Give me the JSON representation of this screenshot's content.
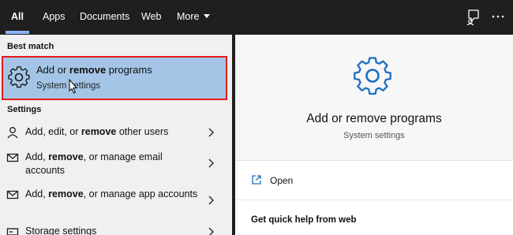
{
  "tabs": [
    {
      "label": "All",
      "active": true
    },
    {
      "label": "Apps"
    },
    {
      "label": "Documents"
    },
    {
      "label": "Web"
    },
    {
      "label": "More"
    }
  ],
  "topbar_icons": [
    "feedback-icon",
    "more-options-icon"
  ],
  "best_match": {
    "section_label": "Best match",
    "title_pre": "Add or ",
    "title_bold": "remove",
    "title_post": " programs",
    "subtitle": "System settings",
    "icon": "gear-icon"
  },
  "settings": {
    "section_label": "Settings",
    "items": [
      {
        "pre": "Add, edit, or ",
        "bold": "remove",
        "post": " other users",
        "icon": "person-icon"
      },
      {
        "pre": "Add, ",
        "bold": "remove",
        "post": ", or manage email accounts",
        "icon": "mail-icon"
      },
      {
        "pre": "Add, ",
        "bold": "remove",
        "post": ", or manage app accounts",
        "icon": "mail-icon"
      },
      {
        "pre": "Storage settings",
        "bold": "",
        "post": "",
        "icon": "storage-icon"
      }
    ]
  },
  "details": {
    "title": "Add or remove programs",
    "subtitle": "System settings",
    "open_label": "Open",
    "help_label": "Get quick help from web"
  },
  "colors": {
    "topbar_bg": "#1f1f1f",
    "selection_bg": "#a4c5e6",
    "selection_border": "#e41b1b",
    "accent": "#1a6fc4"
  }
}
